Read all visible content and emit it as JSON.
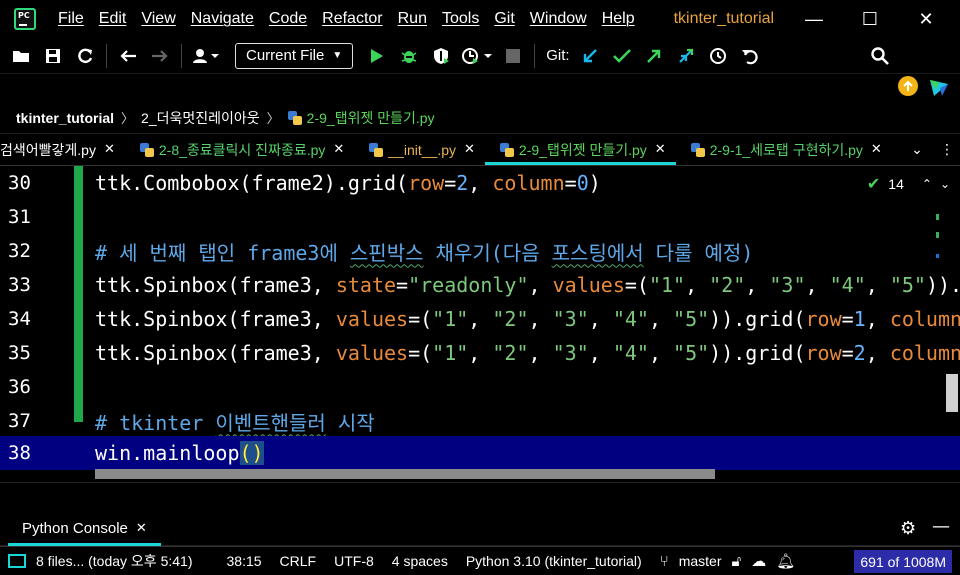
{
  "app": {
    "menu": [
      "File",
      "Edit",
      "View",
      "Navigate",
      "Code",
      "Refactor",
      "Run",
      "Tools",
      "Git",
      "Window",
      "Help"
    ],
    "project_title": "tkinter_tutorial",
    "window_controls": {
      "minimize": "—",
      "maximize": "☐",
      "close": "✕"
    }
  },
  "toolbar": {
    "run_config": "Current File",
    "git_label": "Git:",
    "icons": [
      "open-folder-icon",
      "save-icon",
      "sync-icon",
      "back-arrow-icon",
      "forward-arrow-icon",
      "user-icon",
      "run-icon",
      "debug-icon",
      "coverage-icon",
      "profile-icon",
      "stop-icon",
      "git-update-icon",
      "git-commit-icon",
      "git-push-icon",
      "git-merge-icon",
      "history-icon",
      "rollback-icon",
      "search-icon"
    ]
  },
  "breadcrumb": [
    "tkinter_tutorial",
    "2_더욱멋진레이아웃",
    "2-9_탭위젯 만들기.py"
  ],
  "tabs": [
    {
      "label": "검색어빨갛게.py",
      "close": "✕"
    },
    {
      "label": "2-8_종료클릭시 진짜종료.py",
      "close": "✕"
    },
    {
      "label": "__init__.py",
      "close": "✕"
    },
    {
      "label": "2-9_탭위젯 만들기.py",
      "close": "✕"
    },
    {
      "label": "2-9-1_세로탭 구현하기.py",
      "close": "✕"
    }
  ],
  "editor": {
    "inspection_count": "14",
    "lines": [
      {
        "num": "30"
      },
      {
        "num": "31"
      },
      {
        "num": "32"
      },
      {
        "num": "33"
      },
      {
        "num": "34"
      },
      {
        "num": "35"
      },
      {
        "num": "36"
      },
      {
        "num": "37"
      },
      {
        "num": "38"
      }
    ]
  },
  "console": {
    "tab_label": "Python Console",
    "close": "✕"
  },
  "statusbar": {
    "files": "8 files... (today 오후 5:41)",
    "position": "38:15",
    "line_sep": "CRLF",
    "encoding": "UTF-8",
    "indent": "4 spaces",
    "interpreter": "Python 3.10 (tkinter_tutorial)",
    "branch": "master",
    "memory": "691 of 1008M"
  }
}
